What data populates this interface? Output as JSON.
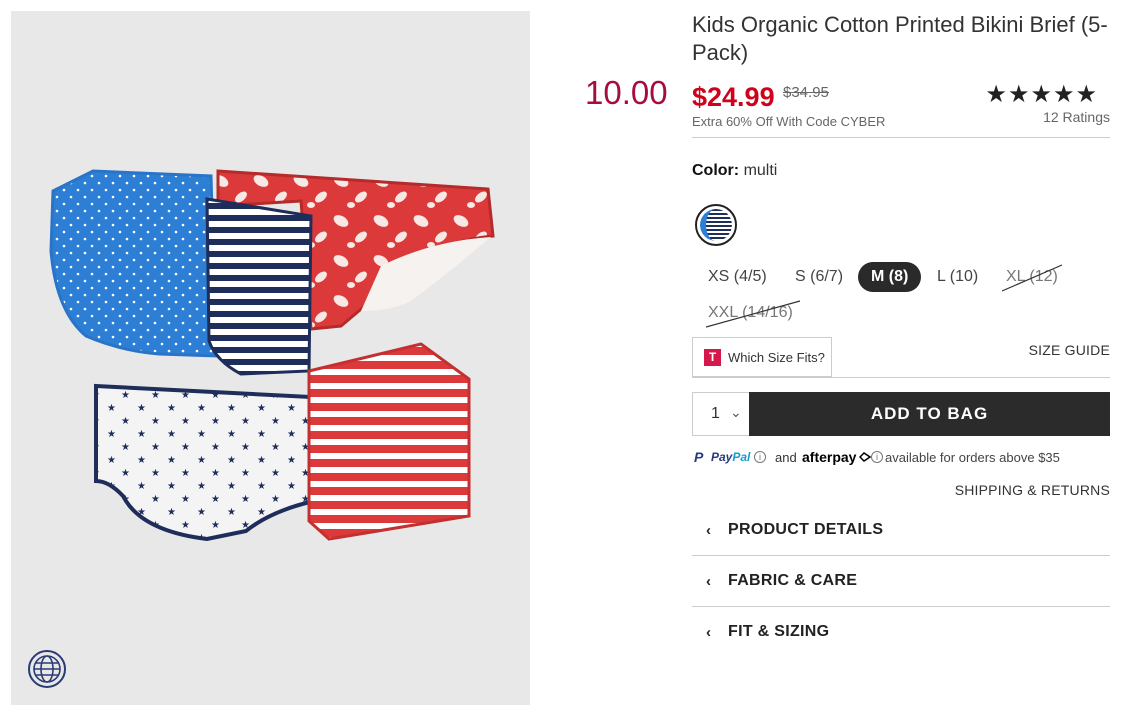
{
  "promo": {
    "price": "10.00",
    "color": "#a50d3f"
  },
  "product": {
    "title": "Kids Organic Cotton Printed Bikini Brief (5-Pack)",
    "sale_price": "$24.99",
    "original_price": "$34.95",
    "promo_text": "Extra 60% Off With Code CYBER",
    "stars": "★★★★★",
    "ratings": "12 Ratings"
  },
  "color": {
    "label": "Color:",
    "value": "multi",
    "swatch": "navy-blue-white-stripe"
  },
  "sizes": [
    {
      "label": "XS (4/5)",
      "state": "available"
    },
    {
      "label": "S (6/7)",
      "state": "available"
    },
    {
      "label": "M (8)",
      "state": "selected"
    },
    {
      "label": "L (10)",
      "state": "available"
    },
    {
      "label": "XL (12)",
      "state": "unavailable"
    },
    {
      "label": "XXL (14/16)",
      "state": "unavailable"
    }
  ],
  "fit": {
    "which_size_label": "Which Size Fits?",
    "size_guide": "SIZE GUIDE"
  },
  "purchase": {
    "quantity": "1",
    "add_label": "ADD TO BAG"
  },
  "payment": {
    "paypal_pay": "Pay",
    "paypal_pal": "Pal",
    "and_text": "and",
    "afterpay": "afterpay",
    "available_text": "available for orders above $35"
  },
  "shipping_link": "SHIPPING & RETURNS",
  "accordions": [
    {
      "label": "PRODUCT DETAILS"
    },
    {
      "label": "FABRIC & CARE"
    },
    {
      "label": "FIT & SIZING"
    }
  ],
  "colors": {
    "sale_red": "#d0021b",
    "promo_crimson": "#a50d3f",
    "button_dark": "#2b2b2b"
  }
}
